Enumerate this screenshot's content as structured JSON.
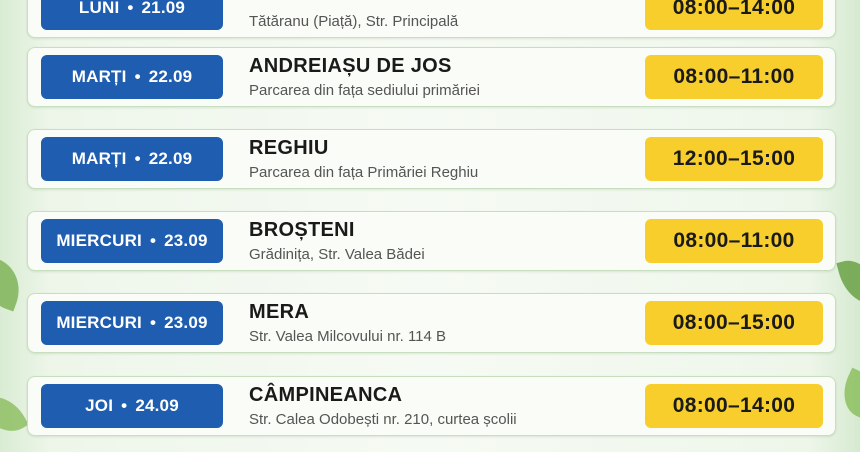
{
  "schedule": [
    {
      "day": "LUNI",
      "date": "21.09",
      "place": "",
      "address": "Tătăranu (Piață), Str. Principală",
      "time": "08:00–14:00"
    },
    {
      "day": "MARȚI",
      "date": "22.09",
      "place": "ANDREIAȘU DE JOS",
      "address": "Parcarea din fața sediului primăriei",
      "time": "08:00–11:00"
    },
    {
      "day": "MARȚI",
      "date": "22.09",
      "place": "REGHIU",
      "address": "Parcarea din fața Primăriei Reghiu",
      "time": "12:00–15:00"
    },
    {
      "day": "MIERCURI",
      "date": "23.09",
      "place": "BROȘTENI",
      "address": "Grădinița, Str. Valea Bădei",
      "time": "08:00–11:00"
    },
    {
      "day": "MIERCURI",
      "date": "23.09",
      "place": "MERA",
      "address": "Str. Valea Milcovului nr. 114 B",
      "time": "08:00–15:00"
    },
    {
      "day": "JOI",
      "date": "24.09",
      "place": "CÂMPINEANCA",
      "address": "Str. Calea Odobești nr. 210, curtea școlii",
      "time": "08:00–14:00"
    }
  ],
  "separator": "•",
  "colors": {
    "day_badge": "#1e5db0",
    "time_badge": "#f8ce2c"
  }
}
